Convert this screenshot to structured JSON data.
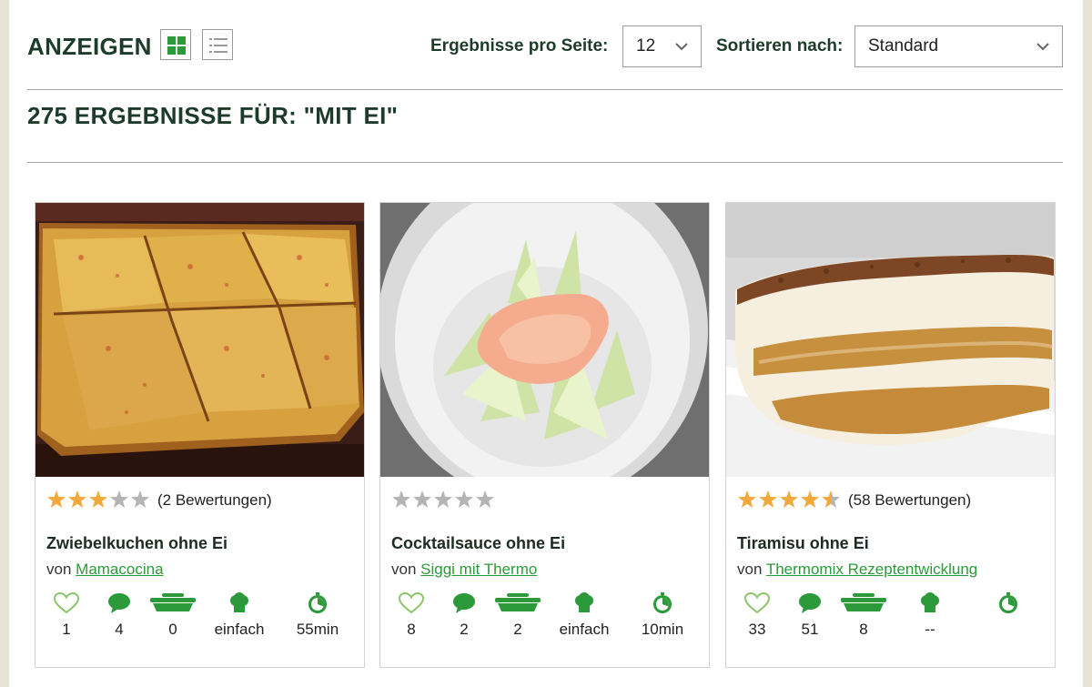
{
  "toolbar": {
    "view_label": "ANZEIGEN",
    "per_page_label": "Ergebnisse pro Seite:",
    "per_page_value": "12",
    "sort_label": "Sortieren nach:",
    "sort_value": "Standard"
  },
  "results_title": "275 ERGEBNISSE FÜR: \"MIT EI\"",
  "colors": {
    "brand_green": "#2c9a3a",
    "heading_green": "#1d3b2b",
    "star_filled": "#f2a93b",
    "star_empty": "#b4b4b4"
  },
  "cards": [
    {
      "rating": 3,
      "rating_text": "(2 Bewertungen)",
      "title": "Zwiebelkuchen ohne Ei",
      "by": "von",
      "author": "Mamacocina",
      "likes": "1",
      "comments": "4",
      "servings": "0",
      "difficulty": "einfach",
      "time": "55min"
    },
    {
      "rating": 0,
      "rating_text": "",
      "title": "Cocktailsauce ohne Ei",
      "by": "von",
      "author": "Siggi mit Thermo",
      "likes": "8",
      "comments": "2",
      "servings": "2",
      "difficulty": "einfach",
      "time": "10min"
    },
    {
      "rating": 4.5,
      "rating_text": "(58 Bewertungen)",
      "title": "Tiramisu ohne Ei",
      "by": "von",
      "author": "Thermomix Rezeptentwicklung",
      "likes": "33",
      "comments": "51",
      "servings": "8",
      "difficulty": "--",
      "time": ""
    }
  ],
  "icons": {
    "view_grid": "grid-view-icon",
    "view_list": "list-view-icon",
    "dropdown": "chevron-down-icon",
    "likes": "heart-icon",
    "comments": "speech-bubble-icon",
    "servings": "serving-dish-icon",
    "difficulty": "chef-hat-icon",
    "time": "timer-icon"
  }
}
